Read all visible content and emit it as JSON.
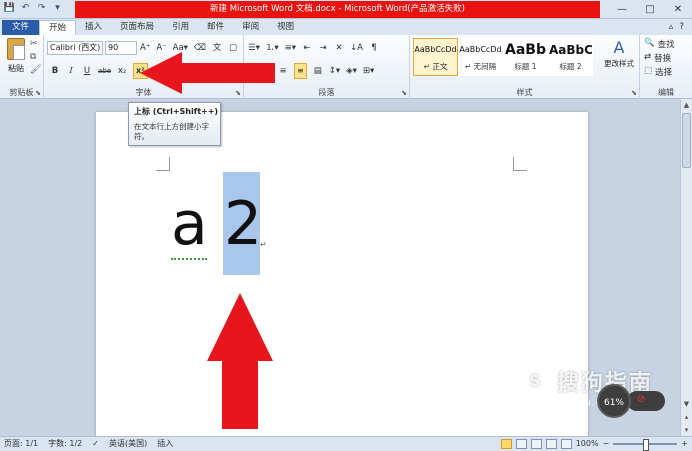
{
  "title": "新建 Microsoft Word 文档.docx - Microsoft Word(产品激活失败)",
  "quick_access": [
    "save-icon",
    "undo-icon",
    "redo-icon",
    "customize-icon"
  ],
  "window_buttons": [
    "—",
    "□",
    "✕"
  ],
  "tabs": [
    "文件",
    "开始",
    "插入",
    "页面布局",
    "引用",
    "邮件",
    "审阅",
    "视图"
  ],
  "ribbon": {
    "clipboard": {
      "paste": "粘贴",
      "label": "剪贴板"
    },
    "font": {
      "name": "Calibri (西文)",
      "size": "90",
      "label": "字体",
      "row2": [
        "B",
        "I",
        "U",
        "abe",
        "x₂",
        "x²"
      ]
    },
    "paragraph": {
      "label": "段落"
    },
    "styles": {
      "label": "样式",
      "items": [
        {
          "preview": "AaBbCcDd",
          "name": "↵ 正文",
          "selected": true
        },
        {
          "preview": "AaBbCcDd",
          "name": "↵ 无间隔",
          "selected": false
        },
        {
          "preview": "AaBb",
          "name": "标题 1",
          "selected": false
        },
        {
          "preview": "AaBbC",
          "name": "标题 2",
          "selected": false
        }
      ],
      "change": "更改样式"
    },
    "editing": {
      "label": "编辑",
      "find": "查找",
      "replace": "替换",
      "select": "选择"
    }
  },
  "tooltip": {
    "title": "上标 (Ctrl+Shift++)",
    "body": "在文本行上方创建小字符。"
  },
  "document": {
    "char_a": "a",
    "char_2": "2",
    "pilcrow": "↵"
  },
  "status": {
    "page": "页面: 1/1",
    "words": "字数: 1/2",
    "lang": "英语(美国)",
    "mode": "插入",
    "zoom": "100%"
  },
  "watermark": {
    "logo": "S",
    "text": "搜狗指南",
    "url": "zhinan.sogou.com",
    "speed": "61%"
  },
  "colors": {
    "annotation_red": "#e8151c",
    "title_red": "#e8130f",
    "file_tab": "#2a5ba6",
    "selection": "#a9c7ec"
  }
}
